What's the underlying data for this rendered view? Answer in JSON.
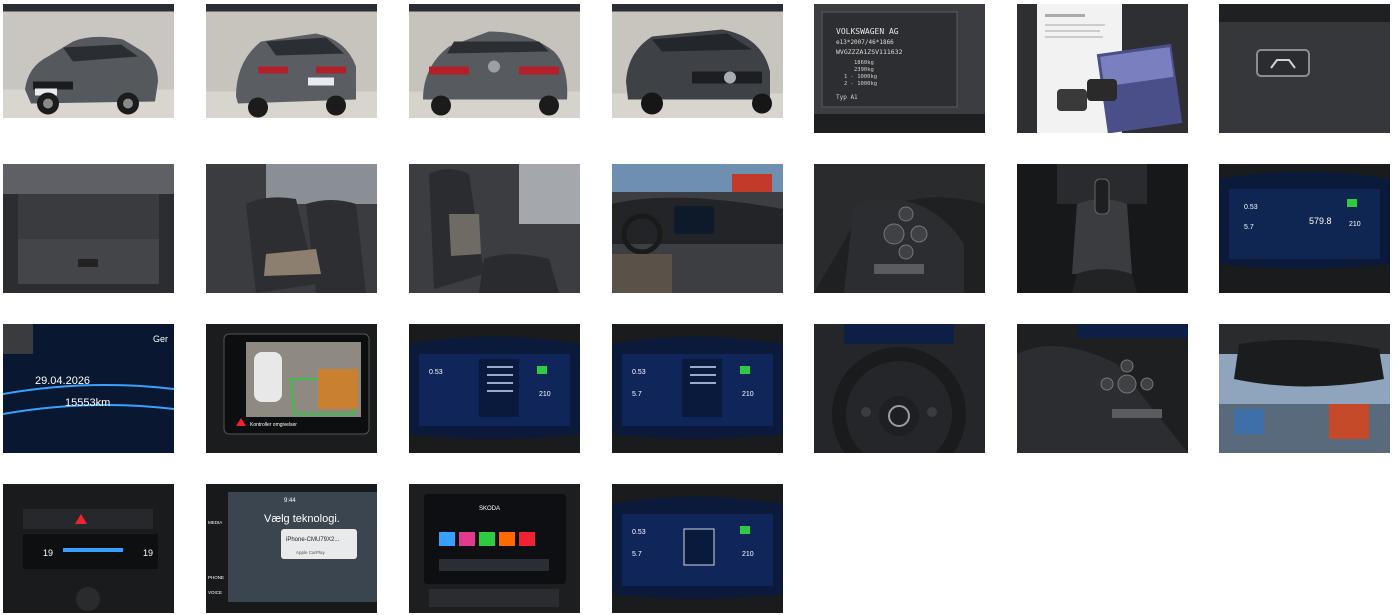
{
  "gallery": {
    "vin_plate": {
      "maker": "VOLKSWAGEN AG",
      "line1": "e13*2007/46*1866",
      "vin": "WVGZZZA1ZSV111632",
      "w1": "1860kg",
      "w2": "2390kg",
      "w3": "1 - 1000kg",
      "w4": "2 - 1000kg",
      "type": "Typ A1"
    },
    "cluster": {
      "trip": "0.53",
      "avg": "5.7",
      "distance": "579.8",
      "range": "210"
    },
    "odometer": {
      "label": "Ger",
      "date": "29.04.2026",
      "km": "15553km"
    },
    "camera": {
      "warning": "Kontroller omgivelser"
    },
    "phone": {
      "title": "Vælg teknologi.",
      "device": "iPhone-CMU79X2...",
      "carplay": "Apple CarPlay",
      "time": "9:44",
      "side_phone": "PHONE",
      "side_voice": "VOICE",
      "side_media": "MEDIA"
    },
    "climate": {
      "left_temp": "19",
      "right_temp": "19"
    },
    "menu": {
      "title": "SKODA"
    }
  }
}
